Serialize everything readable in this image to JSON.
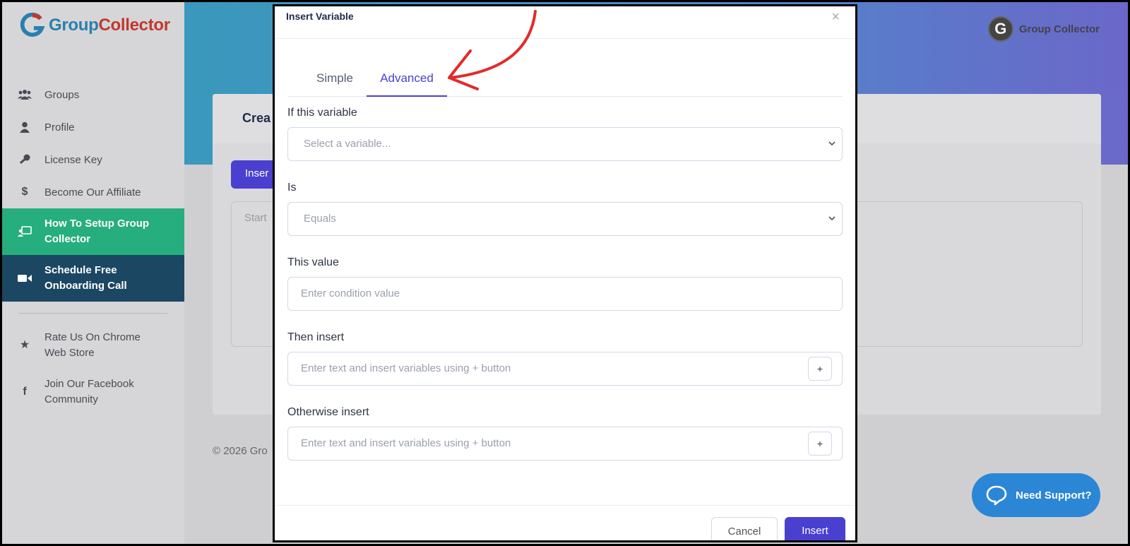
{
  "app": {
    "logo_part1": "Group",
    "logo_part2": "Collector",
    "user_initial": "G",
    "user_name": "Group Collector"
  },
  "sidebar": {
    "items": [
      {
        "label": "Groups",
        "icon": "users-icon"
      },
      {
        "label": "Profile",
        "icon": "user-icon"
      },
      {
        "label": "License Key",
        "icon": "key-icon"
      },
      {
        "label": "Become Our Affiliate",
        "icon": "dollar-icon"
      },
      {
        "label": "How To Setup Group Collector",
        "icon": "tutorial-icon"
      },
      {
        "label": "Schedule Free Onboarding Call",
        "icon": "video-icon"
      },
      {
        "label": "Rate Us On Chrome Web Store",
        "icon": "star-icon"
      },
      {
        "label": "Join Our Facebook Community",
        "icon": "facebook-icon"
      }
    ]
  },
  "background": {
    "card_title": "Crea",
    "insert_button": "Inser",
    "textarea_placeholder": "Start",
    "footer": "© 2026 Gro"
  },
  "support": {
    "label": "Need Support?"
  },
  "modal": {
    "title": "Insert Variable",
    "close": "×",
    "tabs": [
      {
        "label": "Simple"
      },
      {
        "label": "Advanced"
      }
    ],
    "active_tab": "Advanced",
    "fields": {
      "if_variable": {
        "label": "If this variable",
        "placeholder": "Select a variable..."
      },
      "is": {
        "label": "Is",
        "value": "Equals"
      },
      "this_value": {
        "label": "This value",
        "placeholder": "Enter condition value"
      },
      "then_insert": {
        "label": "Then insert",
        "placeholder": "Enter text and insert variables using + button",
        "plus": "+"
      },
      "otherwise_insert": {
        "label": "Otherwise insert",
        "placeholder": "Enter text and insert variables using + button",
        "plus": "+"
      }
    },
    "cancel_label": "Cancel",
    "insert_label": "Insert"
  },
  "colors": {
    "accent": "#4a40d0",
    "green_item": "#27ae7e",
    "navy_item": "#1b4763",
    "annotation_arrow": "#e32b2b",
    "support": "#2b86d6"
  }
}
